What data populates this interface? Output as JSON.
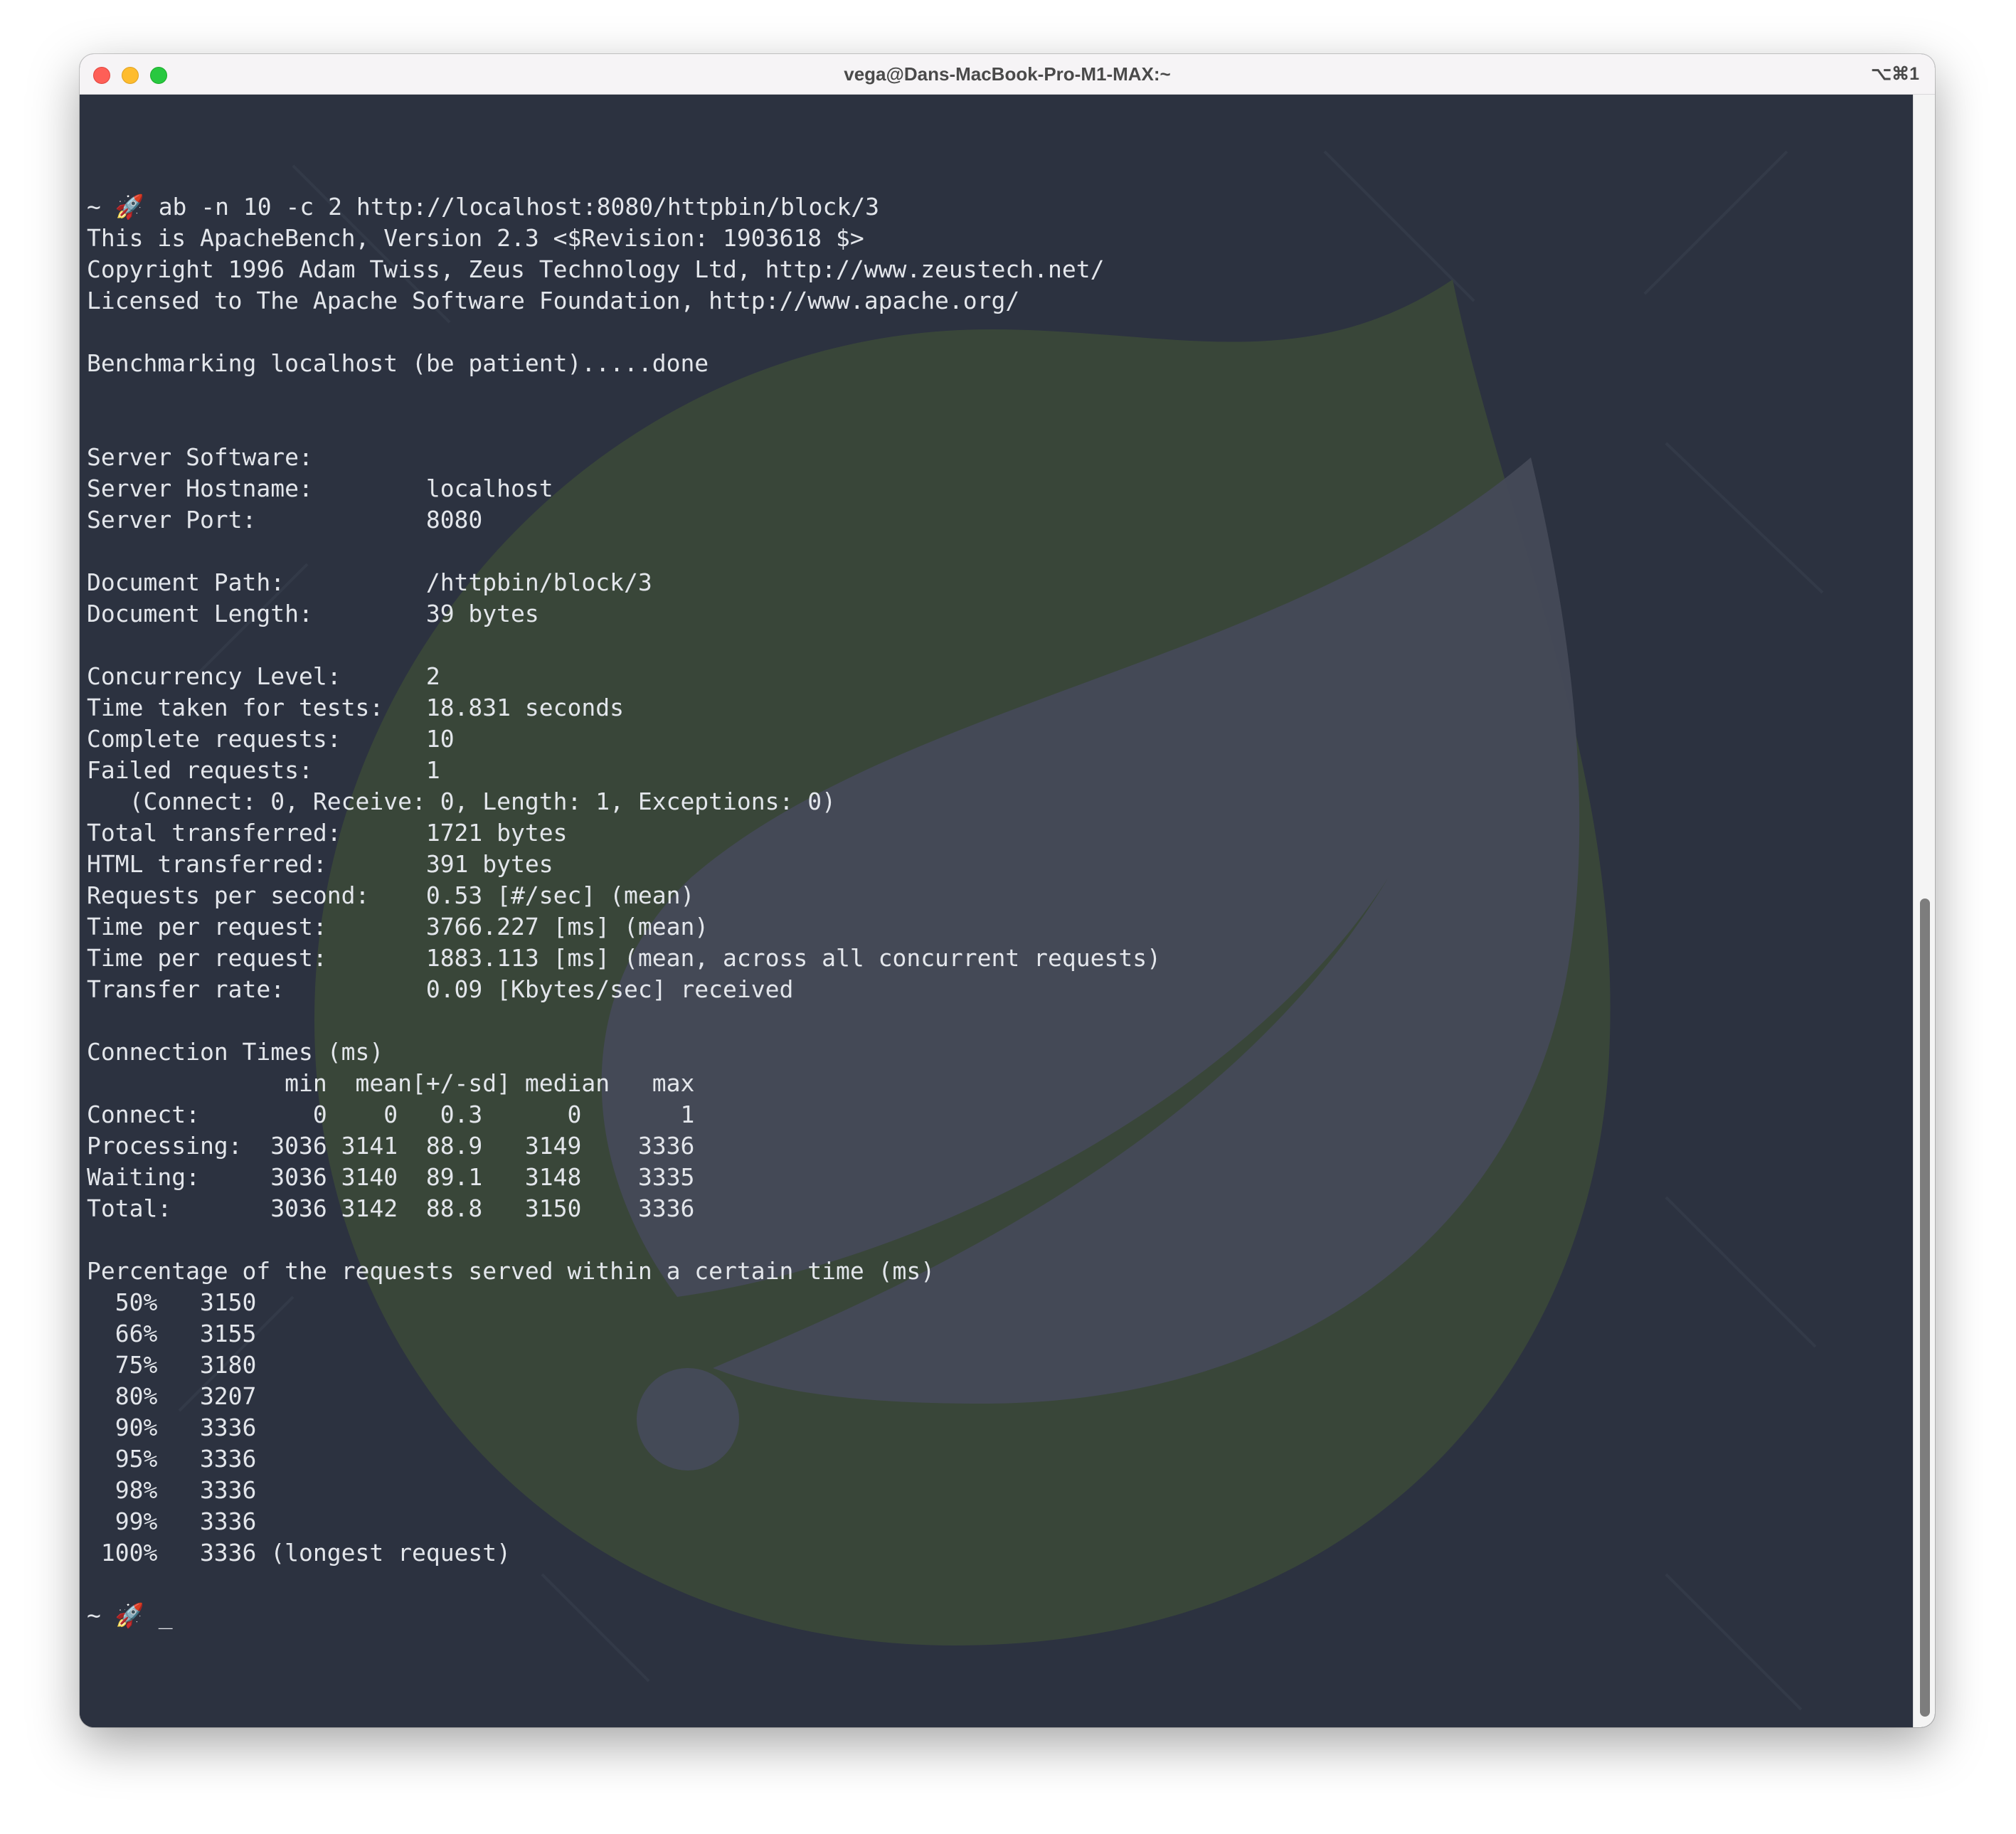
{
  "window": {
    "title": "vega@Dans-MacBook-Pro-M1-MAX:~",
    "shortcut": "⌥⌘1"
  },
  "terminal": {
    "lines": [
      "~ 🚀 ab -n 10 -c 2 http://localhost:8080/httpbin/block/3",
      "This is ApacheBench, Version 2.3 <$Revision: 1903618 $>",
      "Copyright 1996 Adam Twiss, Zeus Technology Ltd, http://www.zeustech.net/",
      "Licensed to The Apache Software Foundation, http://www.apache.org/",
      "",
      "Benchmarking localhost (be patient).....done",
      "",
      "",
      "Server Software:",
      "Server Hostname:        localhost",
      "Server Port:            8080",
      "",
      "Document Path:          /httpbin/block/3",
      "Document Length:        39 bytes",
      "",
      "Concurrency Level:      2",
      "Time taken for tests:   18.831 seconds",
      "Complete requests:      10",
      "Failed requests:        1",
      "   (Connect: 0, Receive: 0, Length: 1, Exceptions: 0)",
      "Total transferred:      1721 bytes",
      "HTML transferred:       391 bytes",
      "Requests per second:    0.53 [#/sec] (mean)",
      "Time per request:       3766.227 [ms] (mean)",
      "Time per request:       1883.113 [ms] (mean, across all concurrent requests)",
      "Transfer rate:          0.09 [Kbytes/sec] received",
      "",
      "Connection Times (ms)",
      "              min  mean[+/-sd] median   max",
      "Connect:        0    0   0.3      0       1",
      "Processing:  3036 3141  88.9   3149    3336",
      "Waiting:     3036 3140  89.1   3148    3335",
      "Total:       3036 3142  88.8   3150    3336",
      "",
      "Percentage of the requests served within a certain time (ms)",
      "  50%   3150",
      "  66%   3155",
      "  75%   3180",
      "  80%   3207",
      "  90%   3336",
      "  95%   3336",
      "  98%   3336",
      "  99%   3336",
      " 100%   3336 (longest request)",
      ""
    ],
    "prompt": "~ 🚀 ",
    "cursor": "_"
  },
  "colors": {
    "terminal_bg": "#2c3240",
    "terminal_fg": "#e3e6eb",
    "logo_leaf": "#3e4a3c"
  }
}
